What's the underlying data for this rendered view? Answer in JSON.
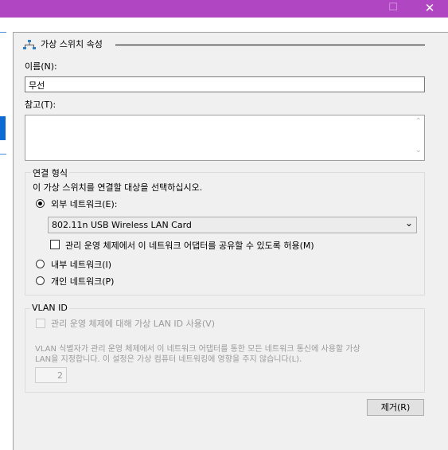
{
  "window": {
    "max_glyph": "☐",
    "close_glyph": "✕"
  },
  "section": {
    "title": "가상 스위치 속성",
    "icon": "network-switch-icon"
  },
  "name_field": {
    "label": "이름(N):",
    "value": "무선"
  },
  "notes_field": {
    "label": "참고(T):",
    "value": ""
  },
  "connection_type": {
    "title": "연결 형식",
    "description": "이 가상 스위치를 연결할 대상을 선택하십시오.",
    "external_label": "외부 네트워크(E):",
    "adapter_selected": "802.11n USB Wireless LAN Card",
    "share_label": "관리 운영 체제에서 이 네트워크 어댑터를 공유할 수 있도록 허용(M)",
    "internal_label": "내부 네트워크(I)",
    "private_label": "개인 네트워크(P)"
  },
  "vlan": {
    "title": "VLAN ID",
    "checkbox_label": "관리 운영 체제에 대해 가상 LAN ID 사용(V)",
    "description_line1": "VLAN 식별자가 관리 운영 체제에서 이 네트워크 어댑터를 통한 모든 네트워크 통신에 사용할 가상",
    "description_line2": "LAN을 지정합니다. 이 설정은 가상 컴퓨터 네트워킹에 영향을 주지 않습니다(L).",
    "id_value": "2"
  },
  "remove_button": "제거(R)",
  "scroll_up_glyph": "⌃",
  "scroll_down_glyph": "⌄",
  "dropdown_glyph": "⌄"
}
